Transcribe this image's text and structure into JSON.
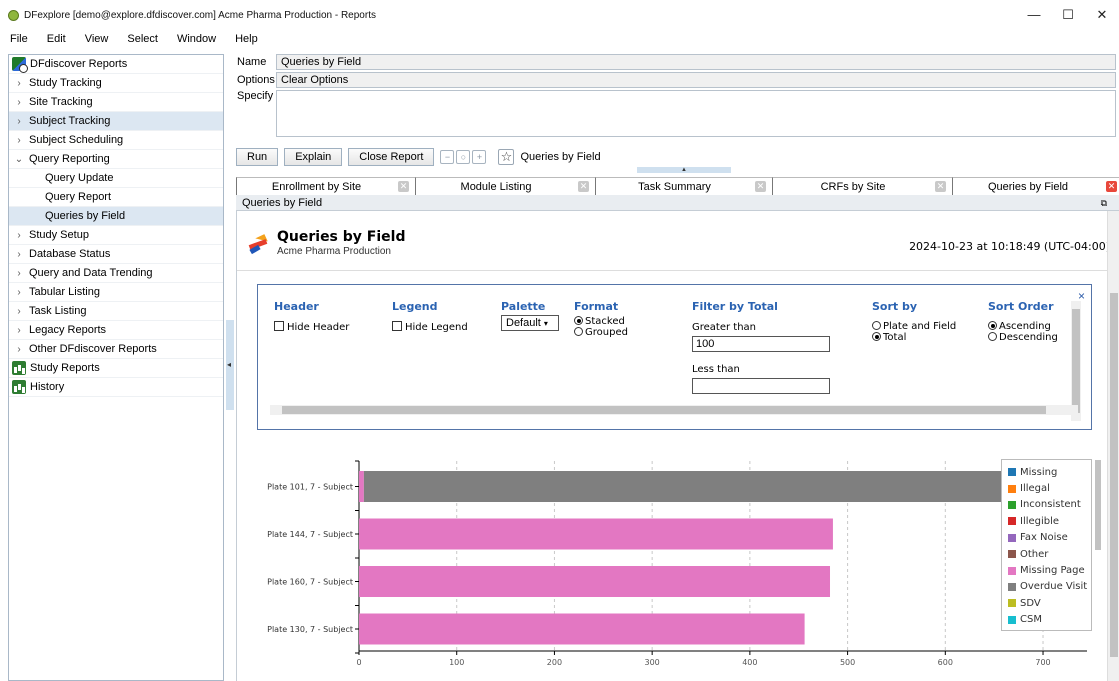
{
  "window": {
    "title": "DFexplore [demo@explore.dfdiscover.com] Acme Pharma Production - Reports",
    "controls": [
      "—",
      "☐",
      "✕"
    ]
  },
  "menu": [
    "File",
    "Edit",
    "View",
    "Select",
    "Window",
    "Help"
  ],
  "tree": {
    "root": "DFdiscover Reports",
    "items": [
      {
        "label": "Study Tracking",
        "chev": ">"
      },
      {
        "label": "Site Tracking",
        "chev": ">"
      },
      {
        "label": "Subject Tracking",
        "chev": ">",
        "selected": true
      },
      {
        "label": "Subject Scheduling",
        "chev": ">"
      },
      {
        "label": "Query Reporting",
        "chev": "v"
      },
      {
        "label": "Query Update",
        "child": true
      },
      {
        "label": "Query Report",
        "child": true
      },
      {
        "label": "Queries by Field",
        "child": true,
        "selected": true
      },
      {
        "label": "Study Setup",
        "chev": ">"
      },
      {
        "label": "Database Status",
        "chev": ">"
      },
      {
        "label": "Query and Data Trending",
        "chev": ">"
      },
      {
        "label": "Tabular Listing",
        "chev": ">"
      },
      {
        "label": "Task Listing",
        "chev": ">"
      },
      {
        "label": "Legacy Reports",
        "chev": ">"
      },
      {
        "label": "Other DFdiscover Reports",
        "chev": ">"
      },
      {
        "label": "Study Reports",
        "icon": "sheet"
      },
      {
        "label": "History",
        "icon": "sheet"
      }
    ]
  },
  "form": {
    "name_label": "Name",
    "name_value": "Queries by Field",
    "options_label": "Options",
    "options_value": "Clear Options",
    "specify_label": "Specify",
    "specify_value": ""
  },
  "toolbar": {
    "run": "Run",
    "explain": "Explain",
    "close_report": "Close Report",
    "current": "Queries by Field"
  },
  "tabs": [
    "Enrollment by Site",
    "Module Listing",
    "Task Summary",
    "CRFs by Site",
    "Queries by Field"
  ],
  "panel_title": "Queries by Field",
  "report": {
    "title": "Queries by Field",
    "subtitle": "Acme Pharma Production",
    "timestamp": "2024-10-23 at 10:18:49 (UTC-04:00)"
  },
  "options": {
    "header": {
      "heading": "Header",
      "checkbox": "Hide Header"
    },
    "legend": {
      "heading": "Legend",
      "checkbox": "Hide Legend"
    },
    "palette": {
      "heading": "Palette",
      "value": "Default"
    },
    "format": {
      "heading": "Format",
      "opt1": "Stacked",
      "opt2": "Grouped"
    },
    "filter": {
      "heading": "Filter by Total",
      "greater_label": "Greater than",
      "greater_value": "100",
      "less_label": "Less than",
      "less_value": ""
    },
    "sortby": {
      "heading": "Sort by",
      "opt1": "Plate and Field",
      "opt2": "Total"
    },
    "sortorder": {
      "heading": "Sort Order",
      "opt1": "Ascending",
      "opt2": "Descending"
    },
    "close": "×"
  },
  "chart_data": {
    "type": "bar",
    "orientation": "horizontal",
    "stacked": true,
    "categories": [
      "Plate 101, 7 - Subject",
      "Plate 144, 7 - Subject",
      "Plate 160, 7 - Subject",
      "Plate 130, 7 - Subject"
    ],
    "series": [
      {
        "name": "Missing",
        "color": "#1f77b4",
        "values": [
          0,
          0,
          0,
          0
        ]
      },
      {
        "name": "Illegal",
        "color": "#ff7f0e",
        "values": [
          0,
          0,
          0,
          0
        ]
      },
      {
        "name": "Inconsistent",
        "color": "#2ca02c",
        "values": [
          0,
          0,
          0,
          0
        ]
      },
      {
        "name": "Illegible",
        "color": "#d62728",
        "values": [
          0,
          0,
          0,
          0
        ]
      },
      {
        "name": "Fax Noise",
        "color": "#9467bd",
        "values": [
          0,
          0,
          0,
          0
        ]
      },
      {
        "name": "Other",
        "color": "#8c564b",
        "values": [
          0,
          0,
          0,
          0
        ]
      },
      {
        "name": "Missing Page",
        "color": "#e377c2",
        "values": [
          5,
          485,
          482,
          456
        ]
      },
      {
        "name": "Overdue Visit",
        "color": "#7f7f7f",
        "values": [
          720,
          0,
          0,
          0
        ]
      },
      {
        "name": "SDV",
        "color": "#bcbd22",
        "values": [
          0,
          0,
          0,
          0
        ]
      },
      {
        "name": "CSM",
        "color": "#17becf",
        "values": [
          0,
          0,
          0,
          0
        ]
      }
    ],
    "xticks": [
      0,
      100,
      200,
      300,
      400,
      500,
      600,
      700
    ],
    "xlim": [
      0,
      745
    ],
    "grid": true,
    "legend_position": "top-right"
  }
}
